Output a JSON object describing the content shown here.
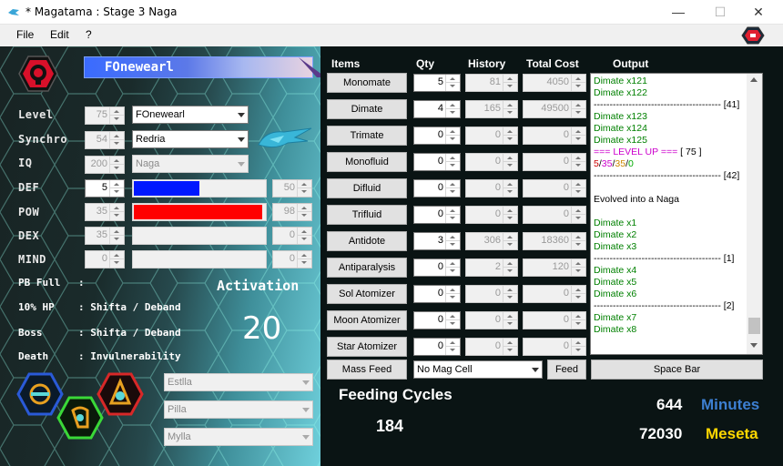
{
  "window": {
    "title": "* Magatama : Stage 3 Naga",
    "minimize": "—",
    "maximize": "☐",
    "close": "✕"
  },
  "menu": [
    "File",
    "Edit",
    "?"
  ],
  "mag": {
    "name": "FOnewearl"
  },
  "stats": {
    "level": {
      "label": "Level",
      "value": "75",
      "combo": "FOnewearl"
    },
    "synchro": {
      "label": "Synchro",
      "value": "54",
      "combo": "Redria"
    },
    "iq": {
      "label": "IQ",
      "value": "200",
      "combo": "Naga"
    },
    "def": {
      "label": "DEF",
      "value": "5",
      "progress": "50",
      "fill": 0.5
    },
    "pow": {
      "label": "POW",
      "value": "35",
      "progress": "98",
      "fill": 0.98
    },
    "dex": {
      "label": "DEX",
      "value": "35",
      "progress": "0",
      "fill": 0
    },
    "mind": {
      "label": "MIND",
      "value": "0",
      "progress": "0",
      "fill": 0
    }
  },
  "pb": [
    {
      "label": "PB Full",
      "value": ":"
    },
    {
      "label": "10% HP",
      "value": ": Shifta / Deband"
    },
    {
      "label": "Boss",
      "value": ": Shifta / Deband"
    },
    {
      "label": "Death",
      "value": ": Invulnerability"
    }
  ],
  "activation": {
    "label": "Activation",
    "value": "20"
  },
  "pb_slots": [
    "Estlla",
    "Pilla",
    "Mylla"
  ],
  "colors": {
    "def_bar": "#0018ff",
    "pow_bar": "#ff0000",
    "accent_blue": "#3d7fd1",
    "accent_yellow": "#ffd700"
  },
  "table": {
    "headers": {
      "items": "Items",
      "qty": "Qty",
      "history": "History",
      "total": "Total Cost",
      "output": "Output"
    },
    "rows": [
      {
        "item": "Monomate",
        "qty": "5",
        "history": "81",
        "total": "4050"
      },
      {
        "item": "Dimate",
        "qty": "4",
        "history": "165",
        "total": "49500"
      },
      {
        "item": "Trimate",
        "qty": "0",
        "history": "0",
        "total": "0"
      },
      {
        "item": "Monofluid",
        "qty": "0",
        "history": "0",
        "total": "0"
      },
      {
        "item": "Difluid",
        "qty": "0",
        "history": "0",
        "total": "0"
      },
      {
        "item": "Trifluid",
        "qty": "0",
        "history": "0",
        "total": "0"
      },
      {
        "item": "Antidote",
        "qty": "3",
        "history": "306",
        "total": "18360"
      },
      {
        "item": "Antiparalysis",
        "qty": "0",
        "history": "2",
        "total": "120"
      },
      {
        "item": "Sol Atomizer",
        "qty": "0",
        "history": "0",
        "total": "0"
      },
      {
        "item": "Moon Atomizer",
        "qty": "0",
        "history": "0",
        "total": "0"
      },
      {
        "item": "Star Atomizer",
        "qty": "0",
        "history": "0",
        "total": "0"
      }
    ]
  },
  "mass_feed": {
    "label": "Mass Feed",
    "cell": "No Mag Cell",
    "feed": "Feed",
    "space": "Space Bar"
  },
  "output_lines": [
    {
      "t": "Dimate x121",
      "c": "#008000"
    },
    {
      "t": "Dimate x122",
      "c": "#008000"
    },
    {
      "t": "---------------------------------------- [41]",
      "c": "#000000"
    },
    {
      "t": "Dimate x123",
      "c": "#008000"
    },
    {
      "t": "Dimate x124",
      "c": "#008000"
    },
    {
      "t": "Dimate x125",
      "c": "#008000"
    },
    {
      "t": "=== LEVEL UP ===",
      "c": "#cc00cc",
      "extra": " [ 75 ]"
    },
    {
      "t": "5/35/35/0",
      "c": "#000000",
      "multi": true
    },
    {
      "t": "---------------------------------------- [42]",
      "c": "#000000"
    },
    {
      "t": "",
      "c": "#000000"
    },
    {
      "t": "Evolved into a Naga",
      "c": "#000000"
    },
    {
      "t": "",
      "c": "#000000"
    },
    {
      "t": "Dimate x1",
      "c": "#008000"
    },
    {
      "t": "Dimate x2",
      "c": "#008000"
    },
    {
      "t": "Dimate x3",
      "c": "#008000"
    },
    {
      "t": "---------------------------------------- [1]",
      "c": "#000000"
    },
    {
      "t": "Dimate x4",
      "c": "#008000"
    },
    {
      "t": "Dimate x5",
      "c": "#008000"
    },
    {
      "t": "Dimate x6",
      "c": "#008000"
    },
    {
      "t": "---------------------------------------- [2]",
      "c": "#000000"
    },
    {
      "t": "Dimate x7",
      "c": "#008000"
    },
    {
      "t": "Dimate x8",
      "c": "#008000"
    }
  ],
  "stat_parts": [
    "5",
    "/",
    "35",
    "/",
    "35",
    "/",
    "0"
  ],
  "feeding": {
    "label": "Feeding Cycles",
    "value": "184"
  },
  "minutes": {
    "value": "644",
    "label": "Minutes"
  },
  "meseta": {
    "value": "72030",
    "label": "Meseta"
  }
}
